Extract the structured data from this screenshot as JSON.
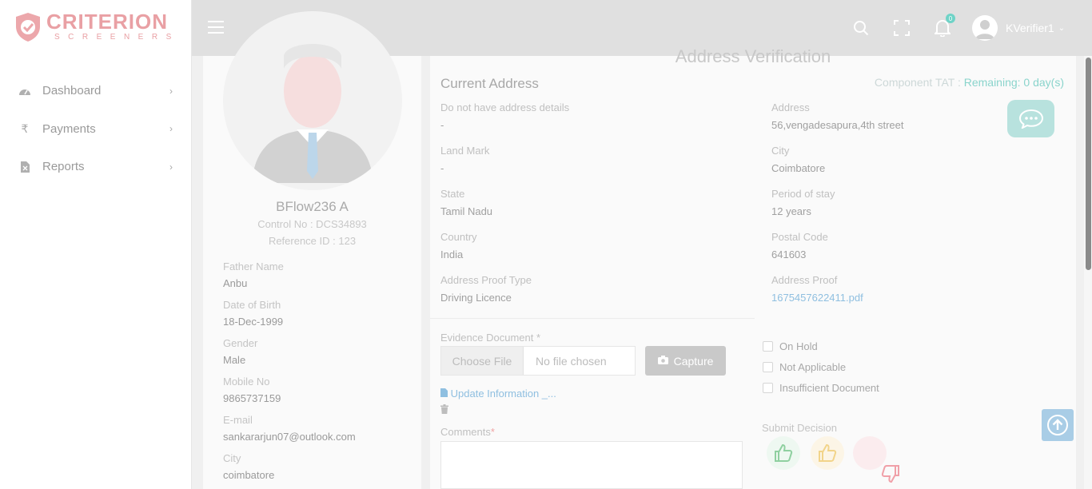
{
  "brand": {
    "name": "CRITERION",
    "tagline": "SCREENERS"
  },
  "sidebar": {
    "items": [
      {
        "label": "Dashboard",
        "icon": "speedometer-icon"
      },
      {
        "label": "Payments",
        "icon": "rupee-icon"
      },
      {
        "label": "Reports",
        "icon": "report-file-icon"
      }
    ]
  },
  "topbar": {
    "notification_count": "0",
    "username": "KVerifier1"
  },
  "profile": {
    "name": "BFlow236 A",
    "control_no": "Control No : DCS34893",
    "reference_id": "Reference ID : 123",
    "fields": [
      {
        "label": "Father Name",
        "value": "Anbu"
      },
      {
        "label": "Date of Birth",
        "value": "18-Dec-1999"
      },
      {
        "label": "Gender",
        "value": "Male"
      },
      {
        "label": "Mobile No",
        "value": "9865737159"
      },
      {
        "label": "E-mail",
        "value": "sankararjun07@outlook.com"
      },
      {
        "label": "City",
        "value": "coimbatore"
      }
    ]
  },
  "verification": {
    "title": "Address Verification",
    "section_title": "Current Address",
    "tat_label": "Component TAT : ",
    "tat_remaining": "Remaining: 0 day(s)",
    "left_fields": [
      {
        "label": "Do not have address details",
        "value": "-"
      },
      {
        "label": "Land Mark",
        "value": "-"
      },
      {
        "label": "State",
        "value": "Tamil Nadu"
      },
      {
        "label": "Country",
        "value": "India"
      },
      {
        "label": "Address Proof Type",
        "value": "Driving Licence"
      }
    ],
    "right_fields": [
      {
        "label": "Address",
        "value": "56,vengadesapura,4th street"
      },
      {
        "label": "City",
        "value": "Coimbatore"
      },
      {
        "label": "Period of stay",
        "value": "12 years"
      },
      {
        "label": "Postal Code",
        "value": "641603"
      },
      {
        "label": "Address Proof",
        "value": "1675457622411.pdf"
      }
    ],
    "evidence_label": "Evidence Document *",
    "choose_file": "Choose File",
    "no_file": "No file chosen",
    "capture": "Capture",
    "update_link": "Update Information _...",
    "comments_label": "Comments",
    "comments_required": "*",
    "checkboxes": [
      "On Hold",
      "Not Applicable",
      "Insufficient Document"
    ],
    "submit_decision": "Submit Decision",
    "decision_colors": {
      "approve": "#8fd0a0",
      "partial": "#f2d48a",
      "reject": "#f0a0a8"
    }
  }
}
